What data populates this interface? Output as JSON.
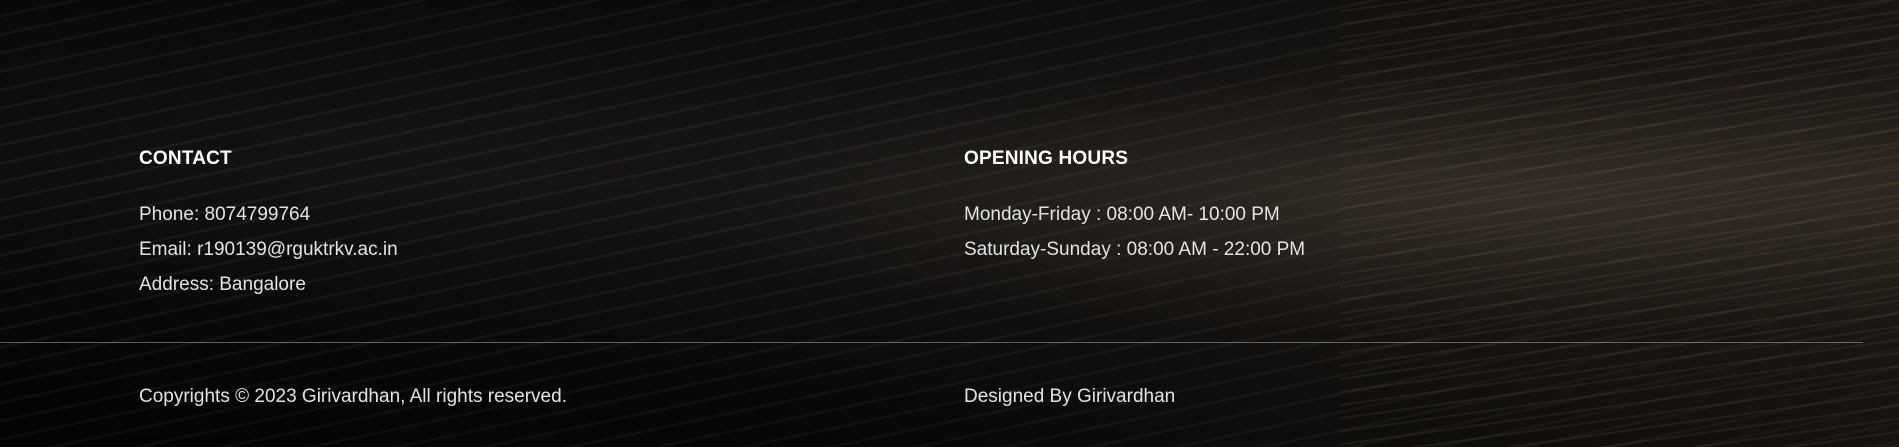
{
  "contact": {
    "heading": "CONTACT",
    "phone": "Phone: 8074799764",
    "email": "Email: r190139@rguktrkv.ac.in",
    "address": "Address: Bangalore"
  },
  "hours": {
    "heading": "OPENING HOURS",
    "weekdays": "Monday-Friday : 08:00 AM- 10:00 PM",
    "weekends": "Saturday-Sunday : 08:00 AM - 22:00 PM"
  },
  "bottom": {
    "copyright": "Copyrights © 2023 Girivardhan, All rights reserved.",
    "designed_by": "Designed By Girivardhan"
  },
  "colors": {
    "heading": "#ffffff",
    "text": "#e3e3e3",
    "background": "#0a0a0a"
  }
}
